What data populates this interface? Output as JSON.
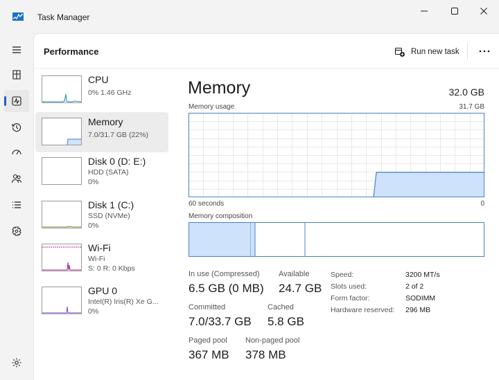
{
  "window": {
    "title": "Task Manager"
  },
  "header": {
    "title": "Performance",
    "run_new_task": "Run new task"
  },
  "devices": [
    {
      "name": "CPU",
      "sub1": "0% 1.46 GHz",
      "sub2": "",
      "sub3": ""
    },
    {
      "name": "Memory",
      "sub1": "7.0/31.7 GB (22%)",
      "sub2": "",
      "sub3": ""
    },
    {
      "name": "Disk 0 (D: E:)",
      "sub1": "HDD (SATA)",
      "sub2": "0%",
      "sub3": ""
    },
    {
      "name": "Disk 1 (C:)",
      "sub1": "SSD (NVMe)",
      "sub2": "0%",
      "sub3": ""
    },
    {
      "name": "Wi-Fi",
      "sub1": "Wi-Fi",
      "sub2": "S: 0 R: 0 Kbps",
      "sub3": ""
    },
    {
      "name": "GPU 0",
      "sub1": "Intel(R) Iris(R) Xe G...",
      "sub2": "0%",
      "sub3": ""
    }
  ],
  "memory": {
    "title": "Memory",
    "total": "32.0 GB",
    "usage_label": "Memory usage",
    "usage_max": "31.7 GB",
    "time_span": "60 seconds",
    "time_end": "0",
    "composition_label": "Memory composition",
    "usage_fraction": 0.22,
    "stats": {
      "in_use_label": "In use (Compressed)",
      "in_use_value": "6.5 GB (0 MB)",
      "available_label": "Available",
      "available_value": "24.7 GB",
      "committed_label": "Committed",
      "committed_value": "7.0/33.7 GB",
      "cached_label": "Cached",
      "cached_value": "5.8 GB",
      "paged_label": "Paged pool",
      "paged_value": "367 MB",
      "nonpaged_label": "Non-paged pool",
      "nonpaged_value": "378 MB"
    },
    "specs": [
      {
        "key": "Speed:",
        "value": "3200 MT/s"
      },
      {
        "key": "Slots used:",
        "value": "2 of 2"
      },
      {
        "key": "Form factor:",
        "value": "SODIMM"
      },
      {
        "key": "Hardware reserved:",
        "value": "296 MB"
      }
    ]
  },
  "colors": {
    "mem_fill": "#cfe2fb",
    "mem_line": "#4a7fc9",
    "cpu": "#1a8b9d",
    "wifi": "#b0238f",
    "gpu": "#7a3fc4",
    "disk": "#6b8e23"
  },
  "icons": {
    "app": "task-manager-icon",
    "minimize": "minimize-icon",
    "maximize": "maximize-icon",
    "close": "close-icon",
    "menu": "hamburger-menu-icon",
    "processes": "processes-icon",
    "performance": "performance-icon",
    "app_history": "app-history-icon",
    "startup": "startup-apps-icon",
    "users": "users-icon",
    "details": "details-icon",
    "services": "services-icon",
    "settings": "settings-icon",
    "run_task": "run-new-task-icon",
    "more": "more-options-icon"
  }
}
